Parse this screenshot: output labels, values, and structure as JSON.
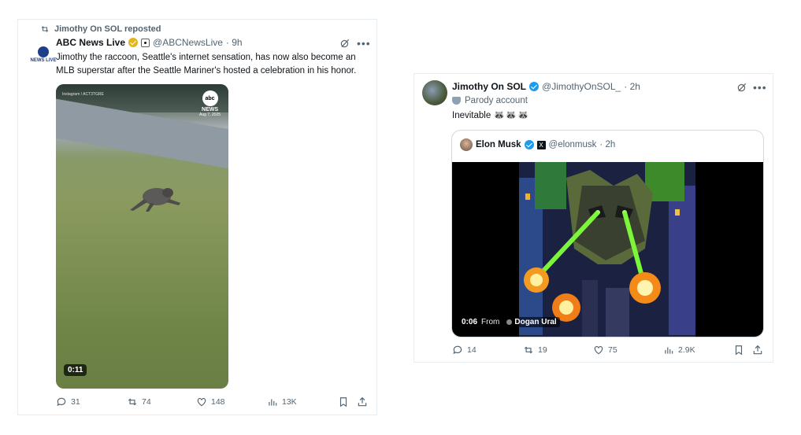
{
  "left_post": {
    "repost_text": "Jimothy On SOL reposted",
    "author_name": "ABC News Live",
    "author_handle": "@ABCNewsLive",
    "time": "· 9h",
    "avatar_label": "NEWS LIVE",
    "text_line1": "Jimothy the raccoon, Seattle's internet sensation, has now also become an",
    "text_line2": "MLB superstar after the Seattle Mariner's hosted a celebration in his honor.",
    "video": {
      "duration": "0:11",
      "watermark_logo": "abc",
      "watermark_news": "NEWS",
      "watermark_date": "Aug 7, 2025",
      "ig_credit": "Instagram / ACT3TGRE"
    },
    "actions": {
      "replies": "31",
      "reposts": "74",
      "likes": "148",
      "views": "13K"
    }
  },
  "right_post": {
    "author_name": "Jimothy On SOL",
    "author_handle": "@JimothyOnSOL_",
    "time": "· 2h",
    "parody_label": "Parody account",
    "text": "Inevitable",
    "emojis": "🦝🦝🦝",
    "quote": {
      "author_name": "Elon Musk",
      "author_handle": "@elonmusk",
      "time": "· 2h",
      "badge_icon": "X",
      "video_time": "0:06",
      "from_label": "From",
      "source_name": "Dogan Ural"
    },
    "actions": {
      "replies": "14",
      "reposts": "19",
      "likes": "75",
      "views": "2.9K"
    }
  },
  "colors": {
    "text_primary": "#0f1419",
    "text_secondary": "#536471",
    "verified_blue": "#1d9bf0",
    "verified_gold": "#e2b719",
    "border": "#e6ecf0"
  }
}
